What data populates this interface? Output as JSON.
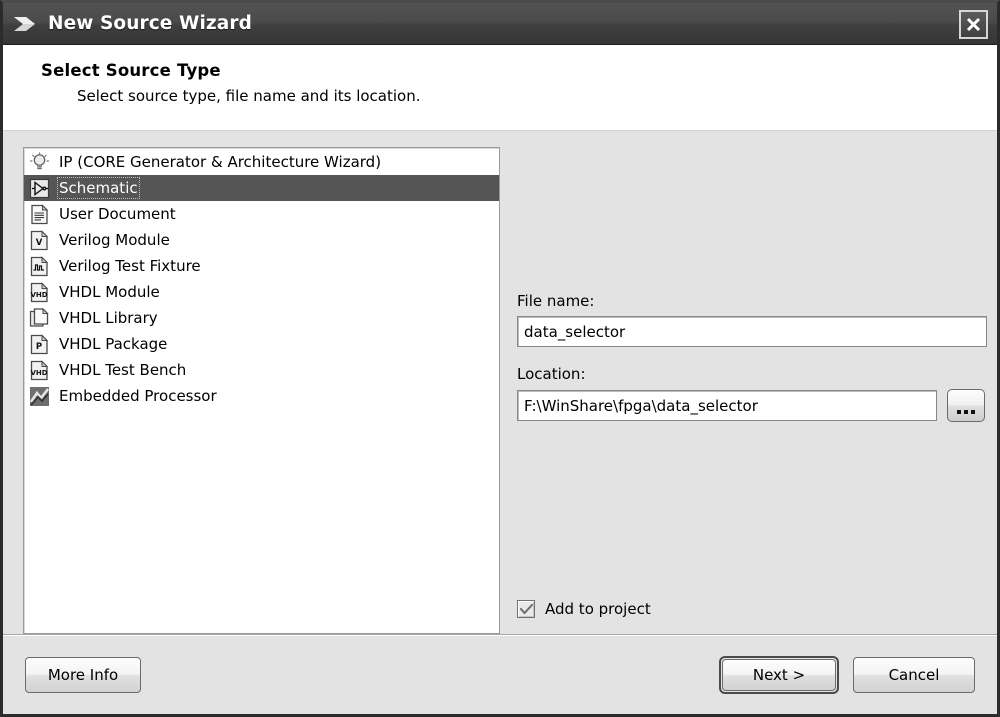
{
  "window": {
    "title": "New Source Wizard",
    "logo_icon": "chevron-logo-icon",
    "close_icon": "close-icon",
    "close_label": "X",
    "titlebar_color": "#474747"
  },
  "header": {
    "title": "Select Source Type",
    "subtitle": "Select source type, file name and its location."
  },
  "source_list": {
    "name": "source-type-list",
    "selected_index": 1,
    "items": [
      {
        "label": "IP (CORE Generator & Architecture Wizard)",
        "icon": "ip-core-lightbulb-icon",
        "selected": false
      },
      {
        "label": "Schematic",
        "icon": "schematic-buffer-icon",
        "selected": true
      },
      {
        "label": "User Document",
        "icon": "user-document-icon",
        "selected": false
      },
      {
        "label": "Verilog Module",
        "icon": "verilog-module-icon",
        "selected": false
      },
      {
        "label": "Verilog Test Fixture",
        "icon": "verilog-test-fixture-icon",
        "selected": false
      },
      {
        "label": "VHDL Module",
        "icon": "vhdl-module-icon",
        "selected": false
      },
      {
        "label": "VHDL Library",
        "icon": "vhdl-library-icon",
        "selected": false
      },
      {
        "label": "VHDL Package",
        "icon": "vhdl-package-icon",
        "selected": false
      },
      {
        "label": "VHDL Test Bench",
        "icon": "vhdl-test-bench-icon",
        "selected": false
      },
      {
        "label": "Embedded Processor",
        "icon": "embedded-processor-icon",
        "selected": false
      }
    ]
  },
  "form": {
    "filename_label": "File name:",
    "filename_value": "data_selector",
    "filename_placeholder": "",
    "location_label": "Location:",
    "location_value": "F:\\WinShare\\fpga\\data_selector",
    "location_placeholder": "",
    "browse_label": "...",
    "browse_icon": "ellipsis-icon",
    "add_to_project_label": "Add to project",
    "add_to_project_checked": true,
    "check_icon": "checkmark-icon"
  },
  "footer": {
    "more_info_label": "More Info",
    "next_label": "Next >",
    "cancel_label": "Cancel",
    "default_button": "Next >"
  }
}
